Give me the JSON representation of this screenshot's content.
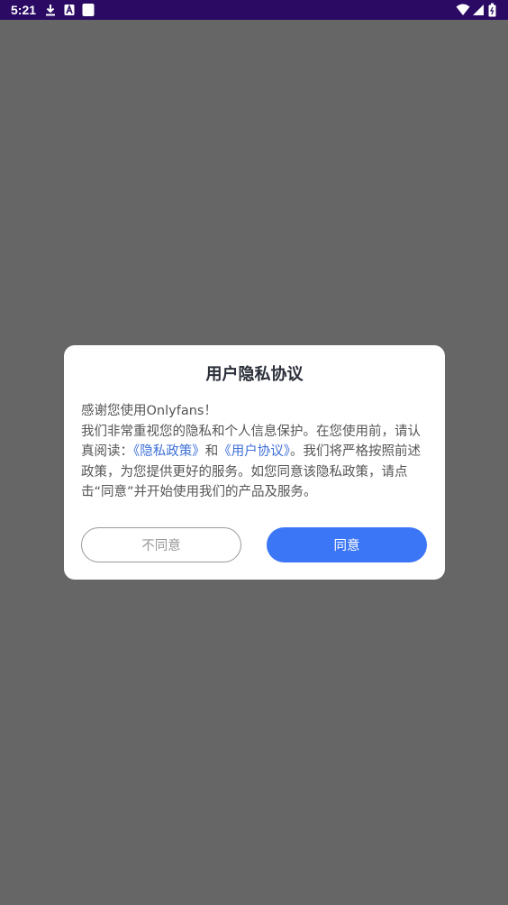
{
  "status_bar": {
    "time": "5:21",
    "left_icons": [
      "download-icon",
      "a-icon",
      "square-icon"
    ],
    "right_icons": [
      "wifi-icon",
      "signal-icon",
      "battery-icon"
    ]
  },
  "dialog": {
    "title": "用户隐私协议",
    "body": {
      "greeting": "感谢您使用Onlyfans！",
      "line_a": "我们非常重视您的隐私和个人信息保护。在您使用前，请认真阅读：",
      "link_privacy": "《隐私政策》",
      "and": "和",
      "link_user_agreement": "《用户协议》",
      "line_b": "。我们将严格按照前述政策，为您提供更好的服务。如您同意该隐私政策，请点击“同意”并开始使用我们的产品及服务。"
    },
    "buttons": {
      "disagree": "不同意",
      "agree": "同意"
    }
  },
  "colors": {
    "status_bar": "#2a0a63",
    "overlay": "#666666",
    "link": "#3d6fd8",
    "primary_button": "#3b76f6"
  }
}
